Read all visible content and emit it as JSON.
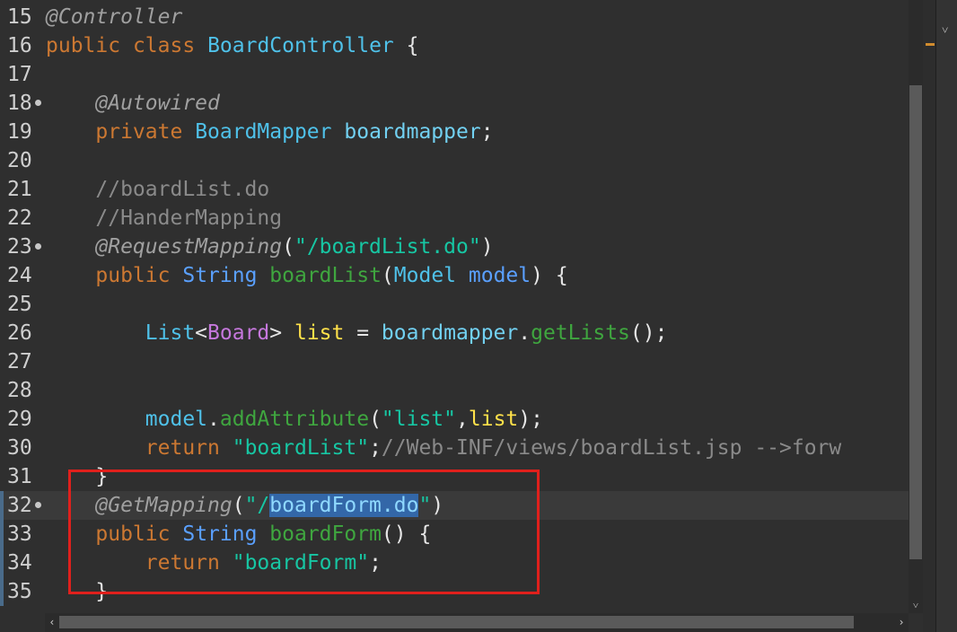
{
  "editor": {
    "lines": [
      {
        "num": "15",
        "fold": false,
        "tokens": [
          [
            "c-ann",
            "@Controller"
          ]
        ]
      },
      {
        "num": "16",
        "fold": false,
        "tokens": [
          [
            "c-kw",
            "public"
          ],
          [
            "c-pl",
            " "
          ],
          [
            "c-kw",
            "class"
          ],
          [
            "c-pl",
            " "
          ],
          [
            "c-ty",
            "BoardController"
          ],
          [
            "c-pl",
            " {"
          ]
        ]
      },
      {
        "num": "17",
        "fold": false,
        "tokens": []
      },
      {
        "num": "18",
        "fold": true,
        "tokens": [
          [
            "c-pl",
            "    "
          ],
          [
            "c-ann",
            "@Autowired"
          ]
        ]
      },
      {
        "num": "19",
        "fold": false,
        "tokens": [
          [
            "c-pl",
            "    "
          ],
          [
            "c-kw",
            "private"
          ],
          [
            "c-pl",
            " "
          ],
          [
            "c-ty",
            "BoardMapper"
          ],
          [
            "c-pl",
            " "
          ],
          [
            "c-fld",
            "boardmapper"
          ],
          [
            "c-pl",
            ";"
          ]
        ]
      },
      {
        "num": "20",
        "fold": false,
        "tokens": []
      },
      {
        "num": "21",
        "fold": false,
        "tokens": [
          [
            "c-pl",
            "    "
          ],
          [
            "c-cm",
            "//boardList.do"
          ]
        ]
      },
      {
        "num": "22",
        "fold": false,
        "tokens": [
          [
            "c-pl",
            "    "
          ],
          [
            "c-cm",
            "//HanderMapping"
          ]
        ]
      },
      {
        "num": "23",
        "fold": true,
        "tokens": [
          [
            "c-pl",
            "    "
          ],
          [
            "c-ann",
            "@RequestMapping"
          ],
          [
            "c-pl",
            "("
          ],
          [
            "c-str",
            "\"/boardList.do\""
          ],
          [
            "c-pl",
            ")"
          ]
        ]
      },
      {
        "num": "24",
        "fold": false,
        "tokens": [
          [
            "c-pl",
            "    "
          ],
          [
            "c-kw",
            "public"
          ],
          [
            "c-pl",
            " "
          ],
          [
            "c-ty2",
            "String"
          ],
          [
            "c-pl",
            " "
          ],
          [
            "c-fn",
            "boardList"
          ],
          [
            "c-pl",
            "("
          ],
          [
            "c-ty",
            "Model"
          ],
          [
            "c-pl",
            " "
          ],
          [
            "c-ty2",
            "model"
          ],
          [
            "c-pl",
            ") {"
          ]
        ]
      },
      {
        "num": "25",
        "fold": false,
        "tokens": []
      },
      {
        "num": "26",
        "fold": false,
        "tokens": [
          [
            "c-pl",
            "        "
          ],
          [
            "c-ty",
            "List"
          ],
          [
            "c-pl",
            "<"
          ],
          [
            "c-gen",
            "Board"
          ],
          [
            "c-pl",
            "> "
          ],
          [
            "c-lst",
            "list"
          ],
          [
            "c-pl",
            " = "
          ],
          [
            "c-fld",
            "boardmapper"
          ],
          [
            "c-pl",
            "."
          ],
          [
            "c-fn",
            "getLists"
          ],
          [
            "c-pl",
            "();"
          ]
        ]
      },
      {
        "num": "27",
        "fold": false,
        "tokens": []
      },
      {
        "num": "28",
        "fold": false,
        "tokens": []
      },
      {
        "num": "29",
        "fold": false,
        "tokens": [
          [
            "c-pl",
            "        "
          ],
          [
            "c-ty",
            "model"
          ],
          [
            "c-pl",
            "."
          ],
          [
            "c-fn",
            "addAttribute"
          ],
          [
            "c-pl",
            "("
          ],
          [
            "c-str",
            "\"list\""
          ],
          [
            "c-pl",
            ","
          ],
          [
            "c-lst",
            "list"
          ],
          [
            "c-pl",
            ");"
          ]
        ]
      },
      {
        "num": "30",
        "fold": false,
        "tokens": [
          [
            "c-pl",
            "        "
          ],
          [
            "c-kw",
            "return"
          ],
          [
            "c-pl",
            " "
          ],
          [
            "c-str",
            "\"boardList\""
          ],
          [
            "c-pl",
            ";"
          ],
          [
            "c-cm",
            "//Web-INF/views/boardList.jsp -->forw"
          ]
        ]
      },
      {
        "num": "31",
        "fold": false,
        "tokens": [
          [
            "c-pl",
            "    }"
          ]
        ]
      },
      {
        "num": "32",
        "fold": true,
        "current": true,
        "tokens": [
          [
            "c-pl",
            "    "
          ],
          [
            "c-ann",
            "@GetMapping"
          ],
          [
            "c-pl",
            "("
          ],
          [
            "c-str",
            "\"/"
          ],
          [
            "c-sel",
            "boardForm.do"
          ],
          [
            "c-str",
            "\""
          ],
          [
            "c-pl",
            ")"
          ]
        ]
      },
      {
        "num": "33",
        "fold": false,
        "tokens": [
          [
            "c-pl",
            "    "
          ],
          [
            "c-kw",
            "public"
          ],
          [
            "c-pl",
            " "
          ],
          [
            "c-ty2",
            "String"
          ],
          [
            "c-pl",
            " "
          ],
          [
            "c-fn",
            "boardForm"
          ],
          [
            "c-pl",
            "() {"
          ]
        ]
      },
      {
        "num": "34",
        "fold": false,
        "tokens": [
          [
            "c-pl",
            "        "
          ],
          [
            "c-kw",
            "return"
          ],
          [
            "c-pl",
            " "
          ],
          [
            "c-str",
            "\"boardForm\""
          ],
          [
            "c-pl",
            ";"
          ]
        ]
      },
      {
        "num": "35",
        "fold": false,
        "tokens": [
          [
            "c-pl",
            "    }"
          ]
        ]
      }
    ]
  },
  "scrollbar": {
    "up_icon": "▲",
    "down_icon": "˅",
    "left_icon": "‹",
    "right_icon": "›"
  },
  "side_panel": {
    "chevron_icon": "˅"
  },
  "colors": {
    "background": "#2f2f2f",
    "highlight_box": "#e0201c",
    "keyword": "#cc7832",
    "string": "#17c6a3",
    "selection": "#3367a8"
  }
}
